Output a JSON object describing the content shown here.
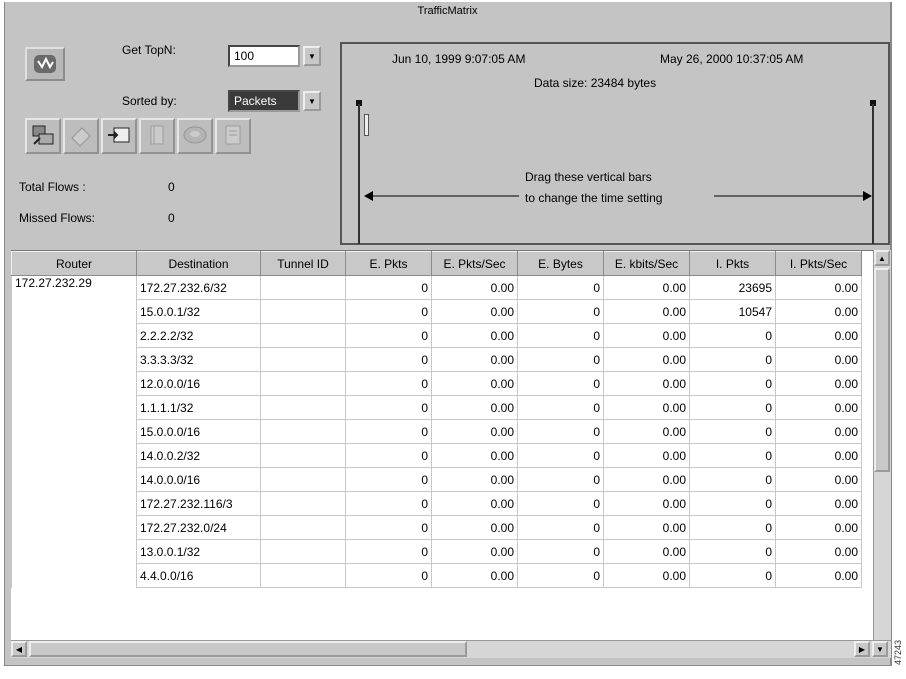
{
  "window": {
    "title": "TrafficMatrix"
  },
  "controls": {
    "get_topn_label": "Get TopN:",
    "get_topn_value": "100",
    "sorted_by_label": "Sorted by:",
    "sorted_by_value": "Packets"
  },
  "stats": {
    "total_flows_label": "Total Flows :",
    "total_flows_value": "0",
    "missed_flows_label": "Missed Flows:",
    "missed_flows_value": "0"
  },
  "timeline": {
    "start_time": "Jun 10, 1999 9:07:05 AM",
    "end_time": "May 26, 2000 10:37:05 AM",
    "data_size": "Data size: 23484 bytes",
    "hint_line1": "Drag these vertical bars",
    "hint_line2": "to change the time setting"
  },
  "table": {
    "columns": [
      "Router",
      "Destination",
      "Tunnel ID",
      "E. Pkts",
      "E. Pkts/Sec",
      "E. Bytes",
      "E. kbits/Sec",
      "I. Pkts",
      "I. Pkts/Sec"
    ],
    "router": "172.27.232.29",
    "rows": [
      [
        "172.27.232.6/32",
        "",
        "0",
        "0.00",
        "0",
        "0.00",
        "23695",
        "0.00"
      ],
      [
        "15.0.0.1/32",
        "",
        "0",
        "0.00",
        "0",
        "0.00",
        "10547",
        "0.00"
      ],
      [
        "2.2.2.2/32",
        "",
        "0",
        "0.00",
        "0",
        "0.00",
        "0",
        "0.00"
      ],
      [
        "3.3.3.3/32",
        "",
        "0",
        "0.00",
        "0",
        "0.00",
        "0",
        "0.00"
      ],
      [
        "12.0.0.0/16",
        "",
        "0",
        "0.00",
        "0",
        "0.00",
        "0",
        "0.00"
      ],
      [
        "1.1.1.1/32",
        "",
        "0",
        "0.00",
        "0",
        "0.00",
        "0",
        "0.00"
      ],
      [
        "15.0.0.0/16",
        "",
        "0",
        "0.00",
        "0",
        "0.00",
        "0",
        "0.00"
      ],
      [
        "14.0.0.2/32",
        "",
        "0",
        "0.00",
        "0",
        "0.00",
        "0",
        "0.00"
      ],
      [
        "14.0.0.0/16",
        "",
        "0",
        "0.00",
        "0",
        "0.00",
        "0",
        "0.00"
      ],
      [
        "172.27.232.116/3",
        "",
        "0",
        "0.00",
        "0",
        "0.00",
        "0",
        "0.00"
      ],
      [
        "172.27.232.0/24",
        "",
        "0",
        "0.00",
        "0",
        "0.00",
        "0",
        "0.00"
      ],
      [
        "13.0.0.1/32",
        "",
        "0",
        "0.00",
        "0",
        "0.00",
        "0",
        "0.00"
      ],
      [
        "4.4.0.0/16",
        "",
        "0",
        "0.00",
        "0",
        "0.00",
        "0",
        "0.00"
      ]
    ]
  },
  "figure_id": "47243",
  "icons": [
    "traffic-matrix-logo-icon",
    "flow-tool-icon",
    "eraser-icon",
    "export-icon",
    "book-icon",
    "disk-icon",
    "document-icon"
  ]
}
